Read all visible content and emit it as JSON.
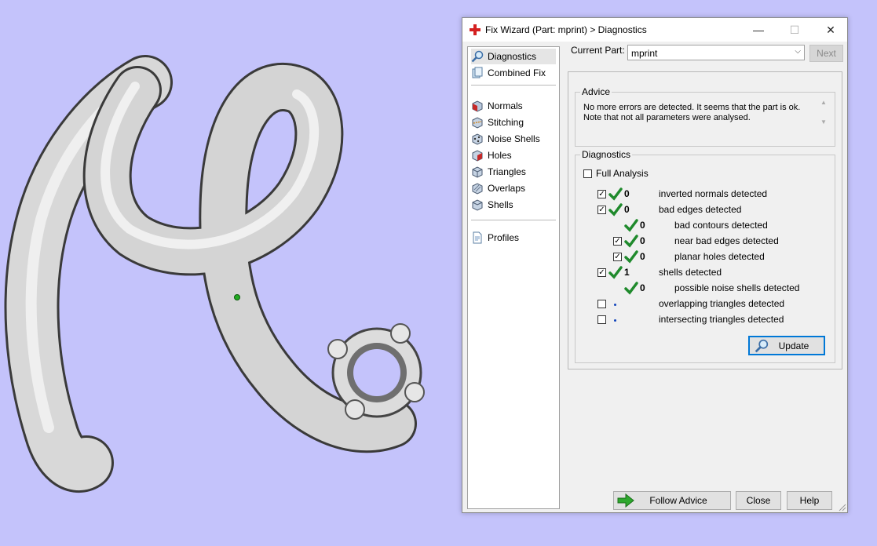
{
  "window": {
    "title": "Fix Wizard (Part: mprint) > Diagnostics",
    "controls": {
      "minimize": "—",
      "maximize": "☐",
      "close": "✕"
    }
  },
  "sidebar": {
    "items": [
      {
        "label": "Diagnostics",
        "icon": "magnifier-icon",
        "selected": true
      },
      {
        "label": "Combined Fix",
        "icon": "pages-icon"
      },
      {
        "label": "Normals",
        "icon": "cube-red-face-icon"
      },
      {
        "label": "Stitching",
        "icon": "cube-stitch-icon"
      },
      {
        "label": "Noise Shells",
        "icon": "cube-noise-icon"
      },
      {
        "label": "Holes",
        "icon": "cube-hole-icon"
      },
      {
        "label": "Triangles",
        "icon": "cube-triangles-icon"
      },
      {
        "label": "Overlaps",
        "icon": "cube-overlap-icon"
      },
      {
        "label": "Shells",
        "icon": "cube-shells-icon"
      },
      {
        "label": "Profiles",
        "icon": "document-icon"
      }
    ]
  },
  "current_part": {
    "label": "Current Part:",
    "value": "mprint"
  },
  "buttons": {
    "next": "Next",
    "update": "Update",
    "follow_advice": "Follow Advice",
    "close": "Close",
    "help": "Help"
  },
  "advice": {
    "title": "Advice",
    "line1": "No more errors are detected. It seems that the part is ok.",
    "line2": "Note that not all parameters were analysed."
  },
  "diagnostics": {
    "title": "Diagnostics",
    "full_analysis": {
      "label": "Full Analysis",
      "checked": false
    },
    "rows": [
      {
        "count": "0",
        "label": "inverted normals detected",
        "checked": true,
        "status": "ok"
      },
      {
        "count": "0",
        "label": "bad edges detected",
        "checked": true,
        "status": "ok"
      },
      {
        "count": "0",
        "label": "bad contours detected",
        "status": "ok"
      },
      {
        "count": "0",
        "label": "near bad edges detected",
        "checked": true,
        "status": "ok"
      },
      {
        "count": "0",
        "label": "planar holes detected",
        "checked": true,
        "status": "ok"
      },
      {
        "count": "1",
        "label": "shells detected",
        "checked": true,
        "status": "ok"
      },
      {
        "count": "0",
        "label": "possible noise shells detected",
        "status": "ok"
      },
      {
        "label": "overlapping triangles detected",
        "checked": false,
        "status": "not-analysed"
      },
      {
        "label": "intersecting triangles detected",
        "checked": false,
        "status": "not-analysed"
      }
    ]
  },
  "colors": {
    "viewport_background": "#c4c3fb",
    "ok_check": "#1f8a2c",
    "close_cross": "#d42020",
    "follow_arrow": "#2ea82e"
  }
}
